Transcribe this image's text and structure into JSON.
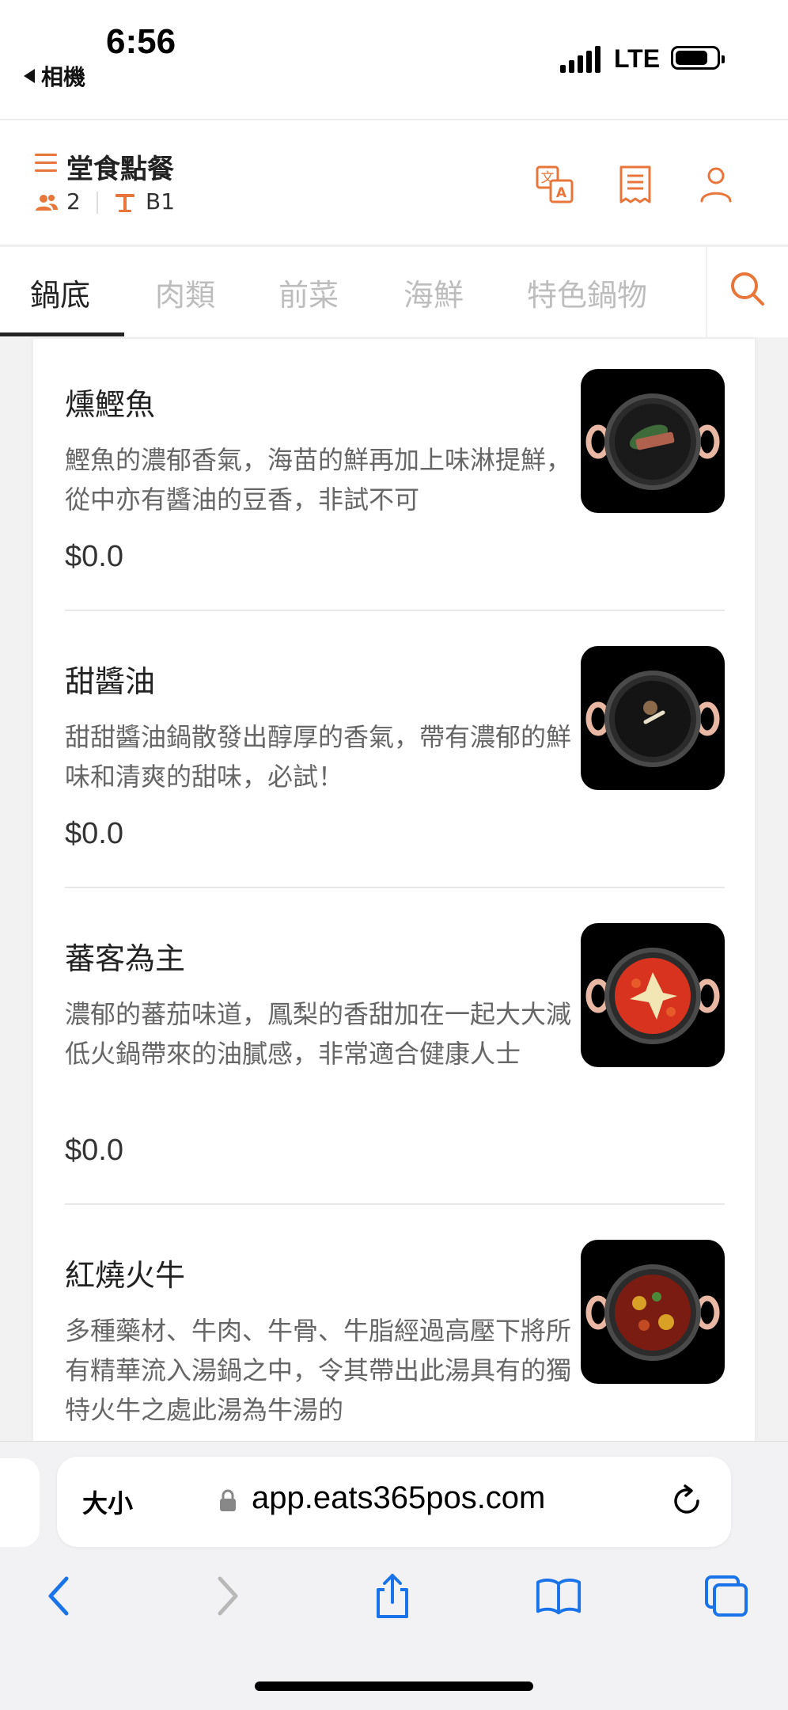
{
  "status_bar": {
    "back_label": "相機",
    "time": "6:56",
    "network": "LTE"
  },
  "header": {
    "title": "堂食點餐",
    "guests": "2",
    "table": "B1"
  },
  "tabs": [
    {
      "label": "鍋底",
      "active": true
    },
    {
      "label": "肉類",
      "active": false
    },
    {
      "label": "前菜",
      "active": false
    },
    {
      "label": "海鮮",
      "active": false
    },
    {
      "label": "特色鍋物",
      "active": false
    }
  ],
  "items": [
    {
      "name": "燻鰹魚",
      "desc": "鰹魚的濃郁香氣，海苗的鮮再加上味淋提鮮，從中亦有醬油的豆香，非試不可",
      "price": "$0.0"
    },
    {
      "name": "甜醬油",
      "desc": "甜甜醬油鍋散發出醇厚的香氣，帶有濃郁的鮮味和清爽的甜味，必試！",
      "price": "$0.0"
    },
    {
      "name": "蕃客為主",
      "desc": "濃郁的蕃茄味道，鳳梨的香甜加在一起大大減低火鍋帶來的油膩感，非常適合健康人士",
      "price": "$0.0"
    },
    {
      "name": "紅燒火牛",
      "desc": "多種藥材、牛肉、牛骨、牛脂經過高壓下將所有精華流入湯鍋之中，令其帶出此湯具有的獨特火牛之處此湯為牛湯的",
      "price": ""
    }
  ],
  "browser": {
    "size_label": "大小",
    "url": "app.eats365pos.com"
  },
  "colors": {
    "accent": "#e8763a",
    "ios_blue": "#1a73e8"
  },
  "icons": {
    "translate": "translate-icon",
    "receipt": "receipt-icon",
    "account": "person-icon",
    "search": "search-icon"
  }
}
